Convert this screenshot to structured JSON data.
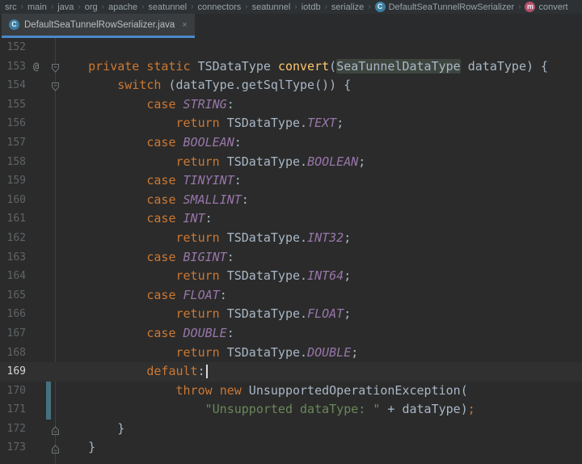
{
  "colors": {
    "editor_bg": "#2b2b2b",
    "navbar_bg": "#2d3134",
    "tabstrip_bg": "#292b2d",
    "tab_bg": "#3a3d3f",
    "tab_underline": "#4a88c7",
    "tab_text": "#bcbec0",
    "breadcrumb_text": "#9aa3a8",
    "class_icon_bg": "#3b7ea1",
    "method_icon_bg": "#b4506a",
    "gutter_separator": "#3c3f41",
    "keyword": "#cc7832",
    "plain": "#a9b7c6",
    "method_decl": "#ffc66d",
    "enum_constant": "#9876aa",
    "string": "#6a8759",
    "line_number": "#5f6467",
    "line_number_current": "#d6d6d6",
    "current_line_bg": "#303030",
    "identifier_highlight_bg": "#3e453f",
    "change_marker": "#46707e",
    "caret": "#d8d8d8",
    "fold_icon": "#6e7577",
    "annotation_icon": "#8a8f91"
  },
  "icons": {
    "class_letter": "C",
    "method_letter": "m"
  },
  "breadcrumb": {
    "separator": "›",
    "items": [
      {
        "label": "src"
      },
      {
        "label": "main"
      },
      {
        "label": "java"
      },
      {
        "label": "org"
      },
      {
        "label": "apache"
      },
      {
        "label": "seatunnel"
      },
      {
        "label": "connectors"
      },
      {
        "label": "seatunnel"
      },
      {
        "label": "iotdb"
      },
      {
        "label": "serialize"
      },
      {
        "label": "DefaultSeaTunnelRowSerializer",
        "icon": "class"
      },
      {
        "label": "convert",
        "icon": "method"
      }
    ]
  },
  "tab": {
    "title": "DefaultSeaTunnelRowSerializer.java",
    "close_glyph": "×"
  },
  "editor": {
    "annotation_glyph": "@",
    "lines": [
      {
        "num": "152",
        "tokens": []
      },
      {
        "num": "153",
        "annot": true,
        "fold": "down",
        "tokens": [
          [
            "    ",
            "pl"
          ],
          [
            "private",
            "kw"
          ],
          [
            " ",
            "pl"
          ],
          [
            "static",
            "kw"
          ],
          [
            " TSDataType ",
            "pl"
          ],
          [
            "convert",
            "me"
          ],
          [
            "(",
            "pl"
          ],
          [
            "SeaTunnelDataType",
            "pl",
            "hl"
          ],
          [
            " dataType) {",
            "pl"
          ]
        ]
      },
      {
        "num": "154",
        "fold": "down",
        "tokens": [
          [
            "        ",
            "pl"
          ],
          [
            "switch",
            "kw"
          ],
          [
            " (dataType.getSqlType()) {",
            "pl"
          ]
        ]
      },
      {
        "num": "155",
        "tokens": [
          [
            "            ",
            "pl"
          ],
          [
            "case",
            "kw"
          ],
          [
            " ",
            "pl"
          ],
          [
            "STRING",
            "en"
          ],
          [
            ":",
            "pl"
          ]
        ]
      },
      {
        "num": "156",
        "tokens": [
          [
            "                ",
            "pl"
          ],
          [
            "return",
            "kw"
          ],
          [
            " TSDataType.",
            "pl"
          ],
          [
            "TEXT",
            "en"
          ],
          [
            ";",
            "pl"
          ]
        ]
      },
      {
        "num": "157",
        "tokens": [
          [
            "            ",
            "pl"
          ],
          [
            "case",
            "kw"
          ],
          [
            " ",
            "pl"
          ],
          [
            "BOOLEAN",
            "en"
          ],
          [
            ":",
            "pl"
          ]
        ]
      },
      {
        "num": "158",
        "tokens": [
          [
            "                ",
            "pl"
          ],
          [
            "return",
            "kw"
          ],
          [
            " TSDataType.",
            "pl"
          ],
          [
            "BOOLEAN",
            "en"
          ],
          [
            ";",
            "pl"
          ]
        ]
      },
      {
        "num": "159",
        "tokens": [
          [
            "            ",
            "pl"
          ],
          [
            "case",
            "kw"
          ],
          [
            " ",
            "pl"
          ],
          [
            "TINYINT",
            "en"
          ],
          [
            ":",
            "pl"
          ]
        ]
      },
      {
        "num": "160",
        "tokens": [
          [
            "            ",
            "pl"
          ],
          [
            "case",
            "kw"
          ],
          [
            " ",
            "pl"
          ],
          [
            "SMALLINT",
            "en"
          ],
          [
            ":",
            "pl"
          ]
        ]
      },
      {
        "num": "161",
        "tokens": [
          [
            "            ",
            "pl"
          ],
          [
            "case",
            "kw"
          ],
          [
            " ",
            "pl"
          ],
          [
            "INT",
            "en"
          ],
          [
            ":",
            "pl"
          ]
        ]
      },
      {
        "num": "162",
        "tokens": [
          [
            "                ",
            "pl"
          ],
          [
            "return",
            "kw"
          ],
          [
            " TSDataType.",
            "pl"
          ],
          [
            "INT32",
            "en"
          ],
          [
            ";",
            "pl"
          ]
        ]
      },
      {
        "num": "163",
        "tokens": [
          [
            "            ",
            "pl"
          ],
          [
            "case",
            "kw"
          ],
          [
            " ",
            "pl"
          ],
          [
            "BIGINT",
            "en"
          ],
          [
            ":",
            "pl"
          ]
        ]
      },
      {
        "num": "164",
        "tokens": [
          [
            "                ",
            "pl"
          ],
          [
            "return",
            "kw"
          ],
          [
            " TSDataType.",
            "pl"
          ],
          [
            "INT64",
            "en"
          ],
          [
            ";",
            "pl"
          ]
        ]
      },
      {
        "num": "165",
        "tokens": [
          [
            "            ",
            "pl"
          ],
          [
            "case",
            "kw"
          ],
          [
            " ",
            "pl"
          ],
          [
            "FLOAT",
            "en"
          ],
          [
            ":",
            "pl"
          ]
        ]
      },
      {
        "num": "166",
        "tokens": [
          [
            "                ",
            "pl"
          ],
          [
            "return",
            "kw"
          ],
          [
            " TSDataType.",
            "pl"
          ],
          [
            "FLOAT",
            "en"
          ],
          [
            ";",
            "pl"
          ]
        ]
      },
      {
        "num": "167",
        "tokens": [
          [
            "            ",
            "pl"
          ],
          [
            "case",
            "kw"
          ],
          [
            " ",
            "pl"
          ],
          [
            "DOUBLE",
            "en"
          ],
          [
            ":",
            "pl"
          ]
        ]
      },
      {
        "num": "168",
        "tokens": [
          [
            "                ",
            "pl"
          ],
          [
            "return",
            "kw"
          ],
          [
            " TSDataType.",
            "pl"
          ],
          [
            "DOUBLE",
            "en"
          ],
          [
            ";",
            "pl"
          ]
        ]
      },
      {
        "num": "169",
        "current": true,
        "caret": true,
        "tokens": [
          [
            "            ",
            "pl"
          ],
          [
            "default",
            "kw"
          ],
          [
            ":",
            "pl"
          ]
        ]
      },
      {
        "num": "170",
        "change": true,
        "tokens": [
          [
            "                ",
            "pl"
          ],
          [
            "throw",
            "kw"
          ],
          [
            " ",
            "pl"
          ],
          [
            "new",
            "kw"
          ],
          [
            " UnsupportedOperationException(",
            "pl"
          ]
        ]
      },
      {
        "num": "171",
        "change": true,
        "tokens": [
          [
            "                    ",
            "pl"
          ],
          [
            "\"Unsupported dataType: \"",
            "st"
          ],
          [
            " + dataType)",
            "pl"
          ],
          [
            ";",
            "kw"
          ]
        ]
      },
      {
        "num": "172",
        "fold": "up",
        "tokens": [
          [
            "        }",
            "pl"
          ]
        ]
      },
      {
        "num": "173",
        "fold": "up",
        "tokens": [
          [
            "    }",
            "pl"
          ]
        ]
      }
    ]
  }
}
